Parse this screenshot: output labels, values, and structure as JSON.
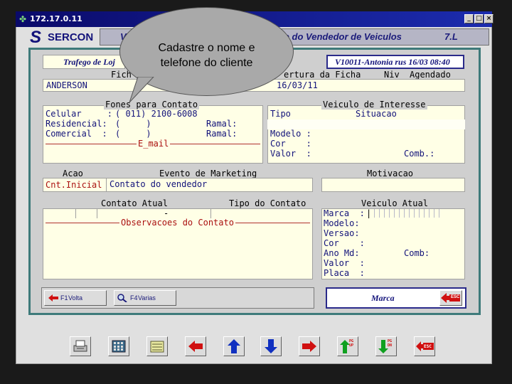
{
  "window": {
    "title": "172.17.0.11",
    "controls": [
      "_",
      "□",
      "×"
    ]
  },
  "header": {
    "logo_s": "S",
    "logo_text": "SERCON",
    "left_text": "V",
    "title": "o do Vendedor de Veiculos",
    "code": "7.L"
  },
  "top_row": {
    "left_label": "Trafego de Loj",
    "user_info": "V10011-Antonia rus 16/03 08:40",
    "col_ficha": "Fich",
    "col_abertura": "ertura da Ficha",
    "col_niv": "Niv",
    "col_agendado": "Agendado",
    "name": "ANDERSON",
    "date": "16/03/11"
  },
  "fones": {
    "header": "Fones para Contato",
    "rows": [
      {
        "label": "Celular     :",
        "value": "( 011) 2100-6008",
        "ramal": ""
      },
      {
        "label": "Residencial:",
        "value": "(     )",
        "ramal": "Ramal:"
      },
      {
        "label": "Comercial  :",
        "value": "(     )",
        "ramal": "Ramal:"
      }
    ],
    "email_label": "E_mail"
  },
  "veiculo_interesse": {
    "header": "Veiculo de Interesse",
    "col_tipo": "Tipo",
    "col_situacao": "Situacao",
    "modelo": "Modelo :",
    "cor": "Cor    :",
    "valor": "Valor  :",
    "comb": "Comb.:"
  },
  "acao": {
    "col_acao": "Acao",
    "col_evento": "Evento de Marketing",
    "col_motivacao": "Motivacao",
    "acao_value": "Cnt.Inicial",
    "evento_value": "Contato do vendedor"
  },
  "contato": {
    "header_atual": "Contato Atual",
    "header_tipo": "Tipo do Contato",
    "dash": "-",
    "obs_label": "Observacoes do Contato"
  },
  "veiculo_atual": {
    "header": "Veiculo Atual",
    "fields": [
      "Marca  :",
      "Modelo:",
      "Versao:",
      "Cor    :",
      "Ano Md:",
      "Valor  :",
      "Placa  :"
    ],
    "comb": "Comb:",
    "marca_cursor": "|"
  },
  "buttons": {
    "volta_key": "F1",
    "volta_label": "Volta",
    "varias_key": "F4",
    "varias_label": "Varias",
    "marca_label": "Marca",
    "esc_label": "ESC"
  },
  "toolbar": {
    "pgup": "PG UP",
    "pgdn": "PG DN",
    "esc": "ESC"
  },
  "tooltip": {
    "line1": "Cadastre o nome e",
    "line2": "telefone do cliente"
  }
}
